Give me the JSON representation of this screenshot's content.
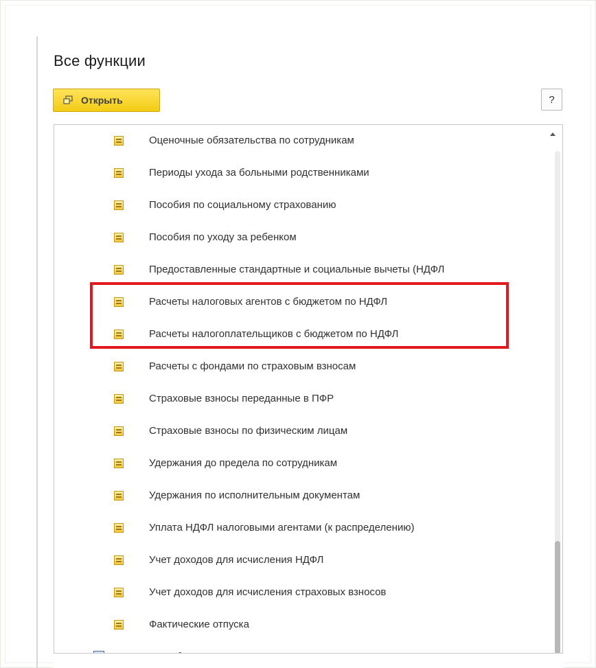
{
  "panel": {
    "title": "Все функции"
  },
  "toolbar": {
    "open_label": "Открыть",
    "help_label": "?"
  },
  "tree": {
    "items": [
      {
        "label": "Оценочные обязательства по сотрудникам",
        "icon": "register-icon"
      },
      {
        "label": "Периоды ухода за больными родственниками",
        "icon": "register-icon"
      },
      {
        "label": "Пособия по социальному страхованию",
        "icon": "register-icon"
      },
      {
        "label": "Пособия по уходу за ребенком",
        "icon": "register-icon"
      },
      {
        "label": "Предоставленные стандартные и социальные вычеты (НДФЛ",
        "icon": "register-icon"
      },
      {
        "label": "Расчеты налоговых агентов с бюджетом по НДФЛ",
        "icon": "register-icon",
        "highlighted": true
      },
      {
        "label": "Расчеты налогоплательщиков с бюджетом по НДФЛ",
        "icon": "register-icon",
        "highlighted": true
      },
      {
        "label": "Расчеты с фондами по страховым взносам",
        "icon": "register-icon"
      },
      {
        "label": "Страховые взносы переданные в ПФР",
        "icon": "register-icon"
      },
      {
        "label": "Страховые взносы по физическим лицам",
        "icon": "register-icon"
      },
      {
        "label": "Удержания до предела по сотрудникам",
        "icon": "register-icon"
      },
      {
        "label": "Удержания по исполнительным документам",
        "icon": "register-icon"
      },
      {
        "label": "Уплата НДФЛ налоговыми агентами (к распределению)",
        "icon": "register-icon"
      },
      {
        "label": "Учет доходов для исчисления НДФЛ",
        "icon": "register-icon"
      },
      {
        "label": "Учет доходов для исчисления страховых взносов",
        "icon": "register-icon"
      },
      {
        "label": "Фактические отпуска",
        "icon": "register-icon"
      }
    ],
    "group_row": {
      "label": "Регистры бухгалтерии",
      "icon": "group-icon"
    }
  },
  "colors": {
    "accent_button": "#f3cc14",
    "highlight_border": "#e1191f"
  }
}
